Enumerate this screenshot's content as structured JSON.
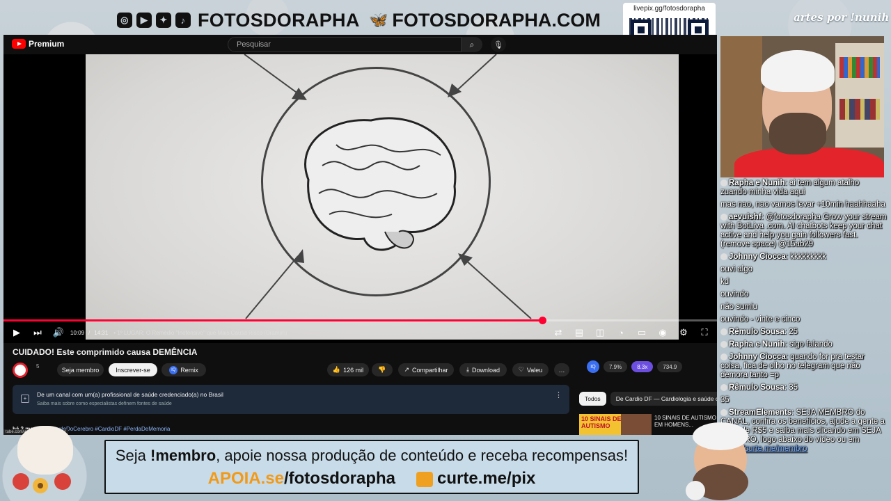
{
  "overlay": {
    "social_handle": "FOTOSDORAPHA",
    "site": "FOTOSDORAPHA.COM",
    "credit": "artes por !nunih",
    "qr_label": "livepix.gg/fotosdorapha",
    "icons": [
      "instagram-icon",
      "youtube-icon",
      "twitter-icon",
      "tiktok-icon",
      "bluesky-icon"
    ]
  },
  "youtube": {
    "logo": "Premium",
    "search_placeholder": "Pesquisar",
    "player": {
      "time_current": "10:09",
      "time_total": "14:31",
      "chapter": "• 1º LUGAR: O Remédio \"Inofensivo\" que Mais Causa Risco (Dramim)",
      "progress": 0.755
    },
    "video_title": "CUIDADO! Este comprimido causa DEMÊNCIA",
    "channel_meta": "5",
    "buttons": {
      "member": "Seja membro",
      "subscribe": "Inscrever-se",
      "remix": "Remix",
      "likes": "126 mil",
      "share": "Compartilhar",
      "download": "Download",
      "thanks": "Valeu",
      "more": "…"
    },
    "health_panel": {
      "title": "De um canal com um(a) profissional de saúde credenciado(a) no Brasil",
      "subtitle": "Saiba mais sobre como especialistas definem fontes de saúde"
    },
    "description": {
      "meta": "há 2 meses",
      "tags": "#SaudeDoCerebro #CardioDF #PerdaDeMemoria"
    },
    "hover_url": "tube.com/watch?v=62KpoNmzM",
    "extension": {
      "iq": "IQ",
      "stat1": "7.9%",
      "stat2": "8.3x",
      "stat3": "734.9"
    },
    "chips": [
      "Todos",
      "De Cardio DF — Cardiologia e saúde ca"
    ],
    "recommended": {
      "thumb_text": "10 SINAIS DE AUTISMO",
      "title": "10 SINAIS DE AUTISMO EM HOMENS..."
    }
  },
  "chat": [
    {
      "user": "Rapha e Nunih",
      "text": "ai tem algum atalho zuando minha vida aqui"
    },
    {
      "user": "",
      "text": "mas nao, nao vamos levar +10min haahhaaha"
    },
    {
      "user": "aevuishf",
      "text": "@fotosdorapha Grow your stream with BotLiva .com. AI chatbots keep your chat active and help you gain followers fast. (remove space) @15ab29"
    },
    {
      "user": "Johnny Ciocca",
      "text": "kkkkkkkkk"
    },
    {
      "user": "",
      "text": "ouvi algo"
    },
    {
      "user": "",
      "text": "kd"
    },
    {
      "user": "",
      "text": "ouvindo"
    },
    {
      "user": "",
      "text": "não sumiu"
    },
    {
      "user": "",
      "text": "ouvindo - vinte e cinco"
    },
    {
      "user": "Rêmulo Sousa",
      "text": "25"
    },
    {
      "user": "Rapha e Nunih",
      "text": "sigo falando"
    },
    {
      "user": "Johnny Ciocca",
      "text": "quando for pra testar coisa, fica de olho no telegram que não demora tanto =p"
    },
    {
      "user": "Rêmulo Sousa",
      "text": "35"
    },
    {
      "user": "",
      "text": "35"
    },
    {
      "user": "StreamElements",
      "text": "SEJA MEMBRO do CANAL, confira os benefícios, ajude a gente a partir de R$5 e saiba mais clicando em SEJA MEMBRO, logo abaixo do vídeo ou em",
      "link": "https://curte.me/membro"
    }
  ],
  "banner": {
    "line1_prefix": "Seja ",
    "line1_bold": "!membro",
    "line1_rest": ", apoie nossa produção de conteúdo e receba recompensas!",
    "apoia": "APOIA.se",
    "apoia_path": "/fotosdorapha",
    "pix": "curte.me/pix"
  }
}
